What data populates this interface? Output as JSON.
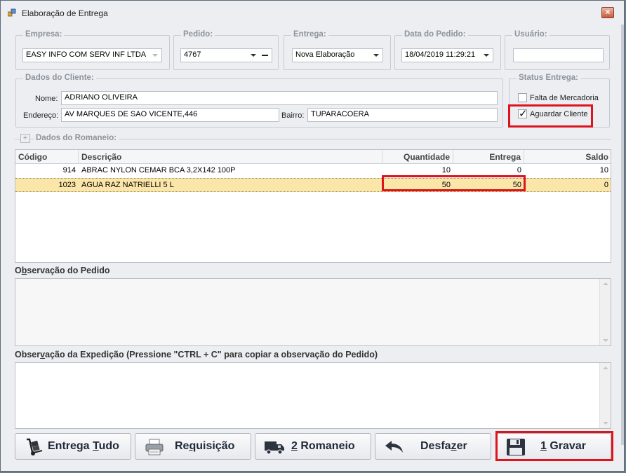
{
  "window": {
    "title": "Elaboração de Entrega",
    "close_label": "×"
  },
  "empresa": {
    "legend": "Empresa:",
    "value": "EASY INFO COM  SERV INF LTDA"
  },
  "pedido": {
    "legend": "Pedido:",
    "value": "4767"
  },
  "entrega": {
    "legend": "Entrega:",
    "value": "Nova Elaboração"
  },
  "data_pedido": {
    "legend": "Data do Pedido:",
    "value": "18/04/2019 11:29:21"
  },
  "usuario": {
    "legend": "Usuário:",
    "value": ""
  },
  "cliente": {
    "legend": "Dados do Cliente:",
    "nome_label": "Nome:",
    "nome": "ADRIANO OLIVEIRA",
    "endereco_label": "Endereço:",
    "endereco": "AV MARQUES DE SAO VICENTE,446",
    "bairro_label": "Bairro:",
    "bairro": "TUPARACOERA"
  },
  "status": {
    "legend": "Status Entrega:",
    "falta_label": "Falta de Mercadoria",
    "falta_checked": false,
    "aguardar_label": "Aguardar Cliente",
    "aguardar_checked": true,
    "check_mark": "✓"
  },
  "romaneio": {
    "legend": "Dados do Romaneio:",
    "expand": "+"
  },
  "grid": {
    "headers": {
      "codigo": "Código",
      "descricao": "Descrição",
      "quantidade": "Quantidade",
      "entrega": "Entrega",
      "saldo": "Saldo"
    },
    "rows": [
      {
        "codigo": "914",
        "descricao": "ABRAC NYLON CEMAR BCA 3,2X142 100P",
        "quantidade": "10",
        "entrega": "0",
        "saldo": "10"
      },
      {
        "codigo": "1023",
        "descricao": "AGUA RAZ NATRIELLI 5 L",
        "quantidade": "50",
        "entrega": "50",
        "saldo": "0"
      }
    ]
  },
  "obs_pedido": {
    "title_pre": "O",
    "title_ul": "b",
    "title_post": "servação do Pedido",
    "value": ""
  },
  "obs_expedicao": {
    "title_pre": "Obser",
    "title_ul": "v",
    "title_post": "ação da Expedição (Pressione \"CTRL + C\" para copiar a observação do Pedido)",
    "value": ""
  },
  "buttons": {
    "entrega_tudo": {
      "pre": "Entrega ",
      "ul": "T",
      "post": "udo"
    },
    "requisicao": {
      "pre": "Re",
      "ul": "q",
      "post": "uisição"
    },
    "romaneio": {
      "pre": "",
      "ul": "2",
      "post": " Romaneio"
    },
    "desfazer": {
      "pre": "Desfa",
      "ul": "z",
      "post": "er"
    },
    "gravar": {
      "pre": "",
      "ul": "1",
      "post": " Gravar"
    }
  },
  "colors": {
    "highlight": "#e0131d",
    "selected_row": "#fbe6a9"
  }
}
